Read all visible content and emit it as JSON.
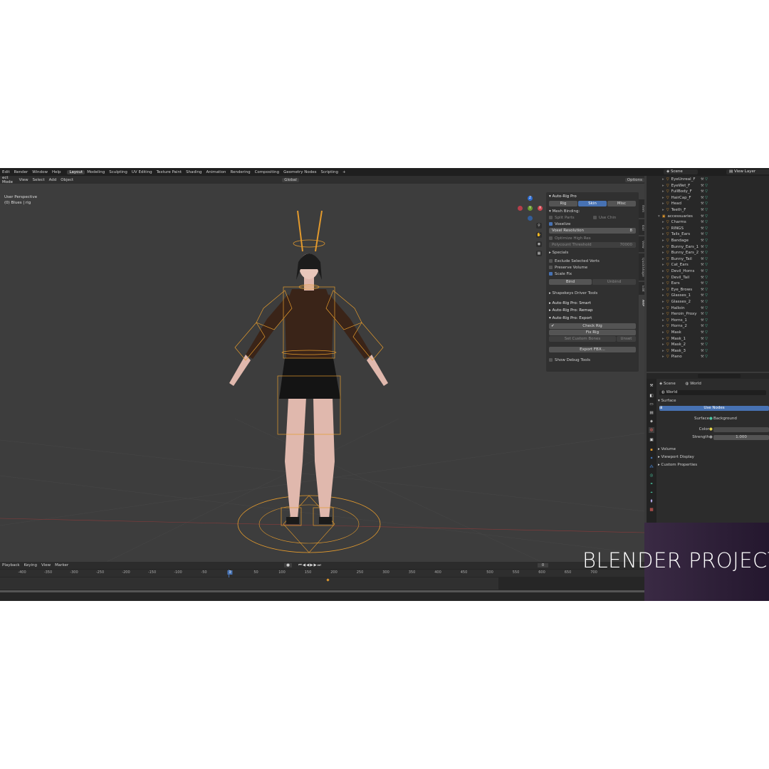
{
  "menus": [
    "Edit",
    "Render",
    "Window",
    "Help"
  ],
  "workspaces": [
    "Layout",
    "Modeling",
    "Sculpting",
    "UV Editing",
    "Texture Paint",
    "Shading",
    "Animation",
    "Rendering",
    "Compositing",
    "Geometry Nodes",
    "Scripting",
    "+"
  ],
  "active_workspace": "Layout",
  "scene_name": "Scene",
  "view_layer": "View Layer",
  "viewport": {
    "mode": "ect Mode",
    "menus": [
      "View",
      "Select",
      "Add",
      "Object"
    ],
    "orientation": "Global",
    "options": "Options",
    "perspective": "User Perspective",
    "object": "(0) Blues | rig"
  },
  "npanel": {
    "title": "Auto-Rig Pro",
    "tabs": [
      "Rig",
      "Skin",
      "Misc"
    ],
    "active_tab": "Skin",
    "mesh_binding": "Mesh Binding:",
    "split_parts": "Split Parts",
    "use_chin": "Use Chin",
    "voxelize": "Voxelize",
    "voxel_resolution_label": "Voxel Resolution",
    "voxel_resolution": "8",
    "optimize_high_res": "Optimize High Res",
    "polycount_threshold": "Polycount Threshold",
    "polycount_value": "70000",
    "specials": "Specials",
    "exclude_selected": "Exclude Selected Verts",
    "preserve_volume": "Preserve Volume",
    "scale_fix": "Scale Fix",
    "bind": "Bind",
    "unbind": "Unbind",
    "shapekeys": "Shapekeys Driver Tools",
    "smart": "Auto-Rig Pro: Smart",
    "remap": "Auto-Rig Pro: Remap",
    "export": "Auto-Rig Pro: Export",
    "check_rig": "Check Rig",
    "fix_rig": "Fix Rig",
    "set_custom_bones": "Set Custom Bones",
    "unset": "Unset",
    "export_fbx": "Export FBX...",
    "show_debug": "Show Debug Tools"
  },
  "side_tabs": [
    "Item",
    "Tool",
    "View",
    "QuickShape",
    "Edit",
    "ARP"
  ],
  "outliner": [
    {
      "name": "EyeUnreal_F",
      "tri": "▸",
      "icon": "▽"
    },
    {
      "name": "EyeWet_F",
      "tri": "▸",
      "icon": "▽"
    },
    {
      "name": "FullBody_F",
      "tri": "▸",
      "icon": "▽"
    },
    {
      "name": "HairCap_F",
      "tri": "▸",
      "icon": "▽"
    },
    {
      "name": "Head",
      "tri": "▸",
      "icon": "▽"
    },
    {
      "name": "Teeth_F",
      "tri": "▸",
      "icon": "▽"
    },
    {
      "name": "accessuaries",
      "tri": "▾",
      "icon": "▣"
    },
    {
      "name": "Charms",
      "tri": "▸",
      "icon": "▽"
    },
    {
      "name": "RINGS",
      "tri": "▸",
      "icon": "▽"
    },
    {
      "name": "Tails_Ears",
      "tri": "▸",
      "icon": "▽"
    },
    {
      "name": "Bandage",
      "tri": "▸",
      "icon": "▽"
    },
    {
      "name": "Bunny_Ears_1",
      "tri": "▸",
      "icon": "▽"
    },
    {
      "name": "Bunny_Ears_2",
      "tri": "▸",
      "icon": "▽"
    },
    {
      "name": "Bunny_Tail",
      "tri": "▸",
      "icon": "▽"
    },
    {
      "name": "Cat_Ears",
      "tri": "▸",
      "icon": "▽"
    },
    {
      "name": "Devil_Horns",
      "tri": "▸",
      "icon": "▽"
    },
    {
      "name": "Devil_Tail",
      "tri": "▸",
      "icon": "▽"
    },
    {
      "name": "Ears",
      "tri": "▸",
      "icon": "▽"
    },
    {
      "name": "Eye_Brows",
      "tri": "▸",
      "icon": "▽"
    },
    {
      "name": "Glasses_1",
      "tri": "▸",
      "icon": "▽"
    },
    {
      "name": "Glasses_2",
      "tri": "▸",
      "icon": "▽"
    },
    {
      "name": "Halloin",
      "tri": "▸",
      "icon": "▽"
    },
    {
      "name": "Heroin_Proxy",
      "tri": "▸",
      "icon": "▽"
    },
    {
      "name": "Horns_1",
      "tri": "▸",
      "icon": "▽"
    },
    {
      "name": "Horns_2",
      "tri": "▸",
      "icon": "▽"
    },
    {
      "name": "Mask",
      "tri": "▸",
      "icon": "▽"
    },
    {
      "name": "Mask_1",
      "tri": "▸",
      "icon": "▽"
    },
    {
      "name": "Mask_2",
      "tri": "▸",
      "icon": "▽"
    },
    {
      "name": "Mask_3",
      "tri": "▸",
      "icon": "▽"
    },
    {
      "name": "Piano",
      "tri": "▸",
      "icon": "▽"
    }
  ],
  "properties": {
    "scene": "Scene",
    "world_tab": "World",
    "world_name": "World",
    "surface_section": "Surface",
    "use_nodes": "Use Nodes",
    "surface_label": "Surface",
    "surface_value": "Background",
    "color_label": "Color",
    "strength_label": "Strength",
    "strength_value": "1.000",
    "volume": "Volume",
    "viewport_display": "Viewport Display",
    "custom_properties": "Custom Properties"
  },
  "timeline": {
    "menus": [
      "Playback",
      "Keying",
      "View",
      "Marker"
    ],
    "current_frame": "0",
    "ticks": [
      "-400",
      "-350",
      "-300",
      "-250",
      "-200",
      "-150",
      "-100",
      "-50",
      "0",
      "50",
      "100",
      "150",
      "200",
      "250",
      "300",
      "350",
      "400",
      "450",
      "500",
      "550",
      "600",
      "650",
      "700"
    ]
  },
  "overlay_text": "BLENDER PROJECT",
  "colors": {
    "accent": "#4772b3",
    "rig": "#e39a2d",
    "bg": "#3d3d3d"
  }
}
